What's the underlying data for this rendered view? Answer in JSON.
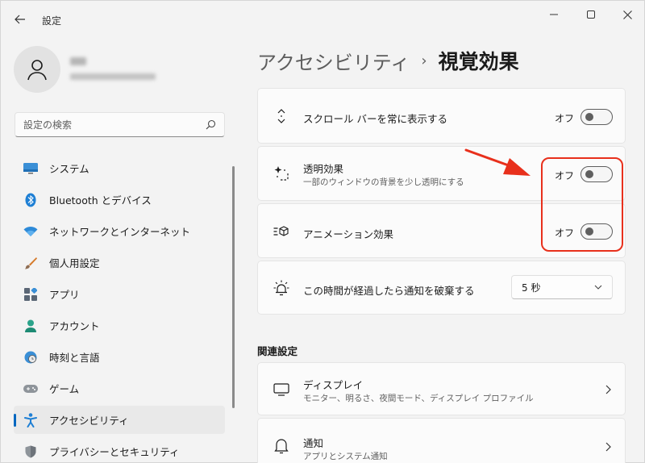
{
  "window": {
    "title": "設定"
  },
  "profile": {},
  "search": {
    "placeholder": "設定の検索"
  },
  "sidebar": {
    "items": [
      {
        "label": "システム",
        "icon": "system-icon"
      },
      {
        "label": "Bluetooth とデバイス",
        "icon": "bluetooth-icon"
      },
      {
        "label": "ネットワークとインターネット",
        "icon": "wifi-icon"
      },
      {
        "label": "個人用設定",
        "icon": "brush-icon"
      },
      {
        "label": "アプリ",
        "icon": "apps-icon"
      },
      {
        "label": "アカウント",
        "icon": "account-icon"
      },
      {
        "label": "時刻と言語",
        "icon": "time-language-icon"
      },
      {
        "label": "ゲーム",
        "icon": "gamepad-icon"
      },
      {
        "label": "アクセシビリティ",
        "icon": "accessibility-icon",
        "active": true
      },
      {
        "label": "プライバシーとセキュリティ",
        "icon": "shield-icon"
      }
    ]
  },
  "breadcrumb": {
    "parent": "アクセシビリティ",
    "separator": "›",
    "current": "視覚効果"
  },
  "settings": {
    "scrollbars": {
      "title": "スクロール バーを常に表示する",
      "state": "オフ",
      "on": false
    },
    "transparency": {
      "title": "透明効果",
      "description": "一部のウィンドウの背景を少し透明にする",
      "state": "オフ",
      "on": false
    },
    "animation": {
      "title": "アニメーション効果",
      "state": "オフ",
      "on": false
    },
    "notification": {
      "title": "この時間が経過したら通知を破棄する",
      "value": "5 秒"
    }
  },
  "related": {
    "title": "関連設定",
    "items": [
      {
        "title": "ディスプレイ",
        "description": "モニター、明るさ、夜間モード、ディスプレイ プロファイル"
      },
      {
        "title": "通知",
        "description": "アプリとシステム通知"
      }
    ]
  },
  "colors": {
    "accent": "#0067c0",
    "annotation": "#e8301c"
  }
}
